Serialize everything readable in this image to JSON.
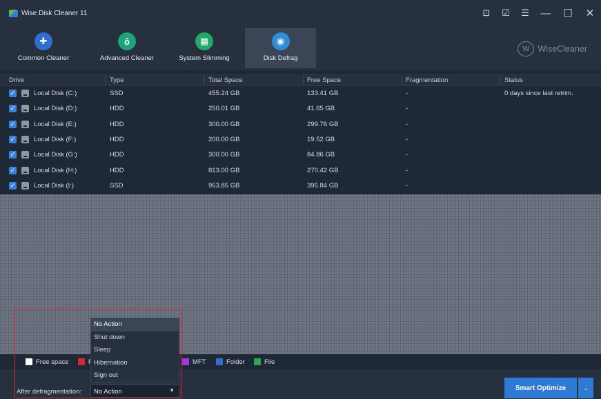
{
  "app": {
    "title": "Wise Disk Cleaner 11"
  },
  "window_controls": [
    {
      "icon": "monitor-icon",
      "glyph": "⊡"
    },
    {
      "icon": "edit-icon",
      "glyph": "☑"
    },
    {
      "icon": "menu-icon",
      "glyph": "☰"
    },
    {
      "icon": "minimize-icon",
      "glyph": "—"
    },
    {
      "icon": "maximize-icon",
      "glyph": "☐"
    },
    {
      "icon": "close-icon",
      "glyph": "✕"
    }
  ],
  "toolbar": {
    "tools": [
      {
        "label": "Common Cleaner",
        "icon": "broom-icon",
        "color": "#2f6fd0",
        "glyph": "✚"
      },
      {
        "label": "Advanced Cleaner",
        "icon": "vacuum-icon",
        "color": "#1fa37a",
        "glyph": "ô"
      },
      {
        "label": "System Slimming",
        "icon": "windows-icon",
        "color": "#21a86b",
        "glyph": "▦"
      },
      {
        "label": "Disk Defrag",
        "icon": "disk-defrag-icon",
        "color": "#2e8fd8",
        "glyph": "◉"
      }
    ],
    "active_index": 3
  },
  "logo": {
    "mark": "W",
    "text": "WiseCleaner"
  },
  "table": {
    "columns": [
      "Drive",
      "Type",
      "Total Space",
      "Free Space",
      "Fragmentation",
      "Status"
    ],
    "rows": [
      {
        "drive": "Local Disk (C:)",
        "type": "SSD",
        "total": "455.24 GB",
        "free": "133.41 GB",
        "frag": "-",
        "status": "0 days since last retrim."
      },
      {
        "drive": "Local Disk (D:)",
        "type": "HDD",
        "total": "250.01 GB",
        "free": "41.65 GB",
        "frag": "-",
        "status": ""
      },
      {
        "drive": "Local Disk (E:)",
        "type": "HDD",
        "total": "300.00 GB",
        "free": "299.76 GB",
        "frag": "-",
        "status": ""
      },
      {
        "drive": "Local Disk (F:)",
        "type": "HDD",
        "total": "200.00 GB",
        "free": "19.52 GB",
        "frag": "-",
        "status": ""
      },
      {
        "drive": "Local Disk (G:)",
        "type": "HDD",
        "total": "300.00 GB",
        "free": "84.86 GB",
        "frag": "-",
        "status": ""
      },
      {
        "drive": "Local Disk (H:)",
        "type": "HDD",
        "total": "813.00 GB",
        "free": "270.42 GB",
        "frag": "-",
        "status": ""
      },
      {
        "drive": "Local Disk (I:)",
        "type": "SSD",
        "total": "953.85 GB",
        "free": "395.84 GB",
        "frag": "-",
        "status": ""
      }
    ]
  },
  "legend": [
    {
      "label": "Free space",
      "color": "#ffffff"
    },
    {
      "label": "F",
      "color": "#d42a2a"
    },
    {
      "label": "MFT",
      "color": "#a23ad8"
    },
    {
      "label": "Folder",
      "color": "#2f6fc8"
    },
    {
      "label": "File",
      "color": "#2ea84a"
    }
  ],
  "after_defrag": {
    "label": "After defragmentation:",
    "selected": "No Action",
    "options": [
      "No Action",
      "Shut down",
      "Sleep",
      "Hibernation",
      "Sign out"
    ]
  },
  "smart_optimize": {
    "label": "Smart Optimize",
    "caret": "⌄"
  }
}
